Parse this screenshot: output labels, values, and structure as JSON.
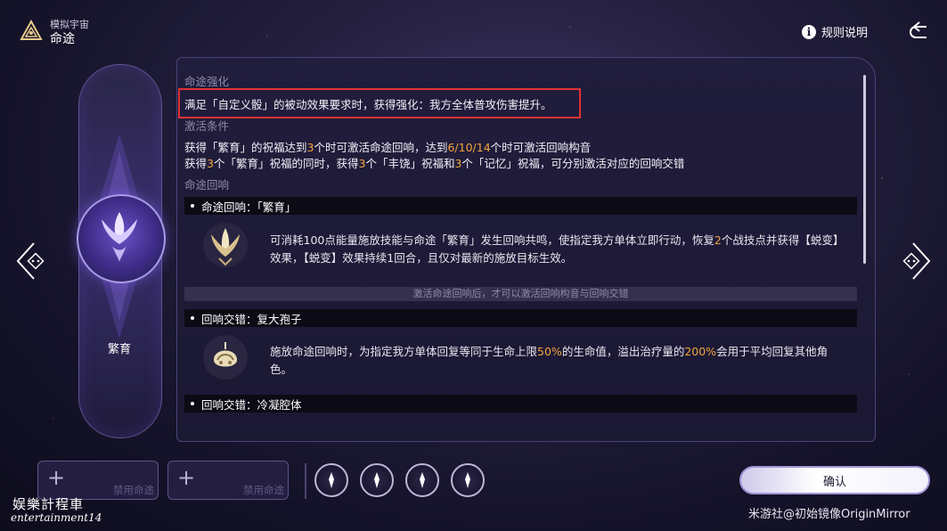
{
  "header": {
    "subtitle": "模拟宇宙",
    "title": "命途",
    "rules_label": "规则说明"
  },
  "path": {
    "name": "繁育"
  },
  "sections": {
    "enhance_title": "命途强化",
    "enhance_text": "满足「自定义骰」的被动效果要求时，获得强化：我方全体普攻伤害提升。",
    "activate_title": "激活条件",
    "activate_line1_a": "获得「繁育」的祝福达到",
    "activate_line1_n1": "3",
    "activate_line1_b": "个时可激活命途回响，达到",
    "activate_line1_n2": "6/10/14",
    "activate_line1_c": "个时可激活回响构音",
    "activate_line2_a": "获得",
    "activate_line2_n1": "3",
    "activate_line2_b": "个「繁育」祝福的同时，获得",
    "activate_line2_n2": "3",
    "activate_line2_c": "个「丰饶」祝福和",
    "activate_line2_n3": "3",
    "activate_line2_d": "个「记忆」祝福，可分别激活对应的回响交错",
    "echo_title": "命途回响"
  },
  "echo": {
    "title": "命途回响：「繁育」",
    "desc_a": "可消耗100点能量施放技能与命途「繁育」发生回响共鸣，使指定我方单体立即行动，恢复",
    "desc_n": "2",
    "desc_b": "个战技点并获得【蜕变】效果，【蜕变】效果持续1回合，且仅对最新的施放目标生效。"
  },
  "divider_text": "激活命途回响后，才可以激活回响构音与回响交错",
  "crossing1": {
    "title": "回响交错：复大孢子",
    "desc_a": "施放命途回响时，为指定我方单体回复等同于生命上限",
    "desc_n1": "50%",
    "desc_b": "的生命值，溢出治疗量的",
    "desc_n2": "200%",
    "desc_c": "会用于平均回复其他角色。"
  },
  "crossing2": {
    "title": "回响交错：冷凝腔体"
  },
  "bottom": {
    "slot1_label": "禁用命途",
    "slot2_label": "禁用命途",
    "confirm_label": "确认"
  },
  "watermarks": {
    "cn": "娱樂計程車",
    "en": "entertainment14",
    "source": "米游社@初始镜像OriginMirror"
  },
  "colors": {
    "highlight_number": "#f2a541",
    "annotation_box": "#e03131"
  }
}
